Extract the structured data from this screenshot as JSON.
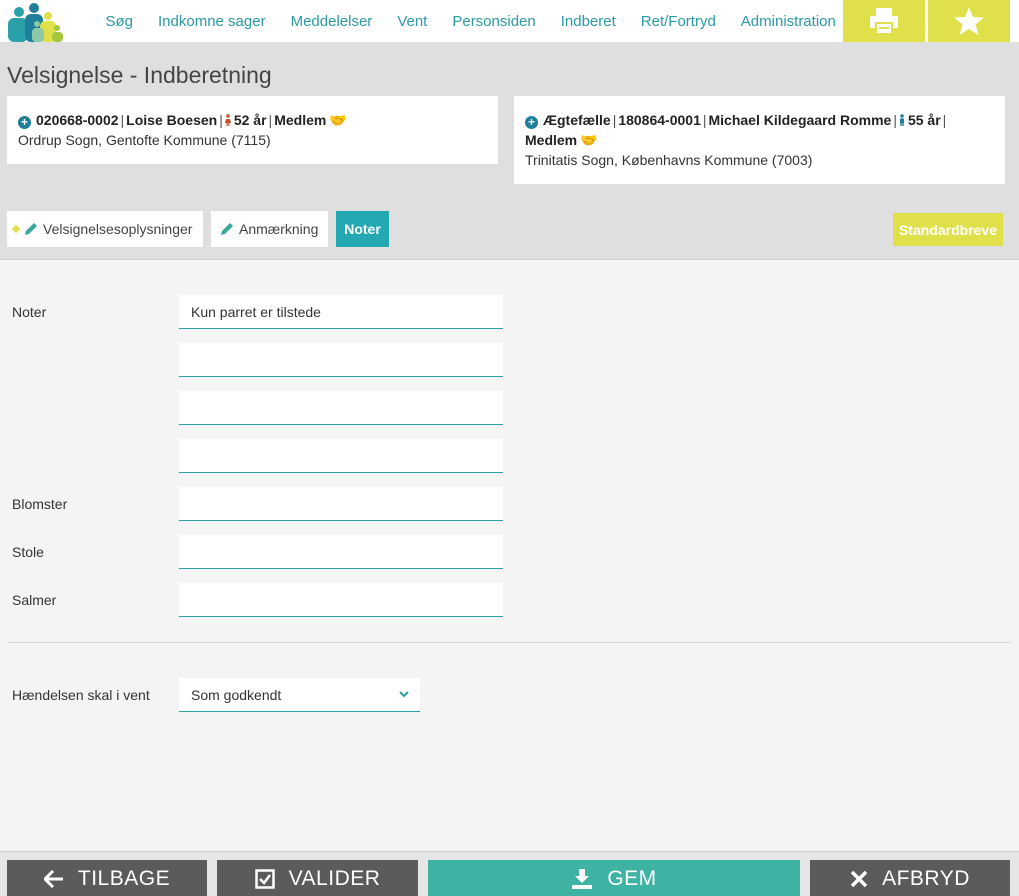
{
  "nav": {
    "items": [
      "Søg",
      "Indkomne sager",
      "Meddelelser",
      "Vent",
      "Personsiden",
      "Indberet",
      "Ret/Fortryd",
      "Administration"
    ],
    "print_icon": "printer-icon",
    "star_icon": "star-icon"
  },
  "header": {
    "title": "Velsignelse - Indberetning",
    "person1": {
      "id": "020668-0002",
      "name": "Loise Boesen",
      "age": "52 år",
      "status": "Medlem",
      "parish": "Ordrup Sogn, Gentofte Kommune (7115)"
    },
    "person2": {
      "role": "Ægtefælle",
      "id": "180864-0001",
      "name": "Michael Kildegaard Romme",
      "age": "55 år",
      "status": "Medlem",
      "parish": "Trinitatis Sogn, Københavns Kommune (7003)"
    },
    "tabs": [
      "Velsignelsesoplysninger",
      "Anmærkning",
      "Noter"
    ],
    "standard_button": "Standardbreve"
  },
  "form": {
    "noter_label": "Noter",
    "noter_values": [
      "Kun parret er tilstede",
      "",
      "",
      ""
    ],
    "blomster_label": "Blomster",
    "blomster_value": "",
    "stole_label": "Stole",
    "stole_value": "",
    "salmer_label": "Salmer",
    "salmer_value": "",
    "vent_label": "Hændelsen skal i vent",
    "vent_value": "Som godkendt"
  },
  "footer": {
    "back": "TILBAGE",
    "validate": "VALIDER",
    "save": "GEM",
    "cancel": "AFBRYD"
  },
  "colors": {
    "accent": "#24a9b3",
    "yellow": "#dfe04a",
    "save_green": "#3eb3a3",
    "dark_button": "#5b5b5b"
  }
}
